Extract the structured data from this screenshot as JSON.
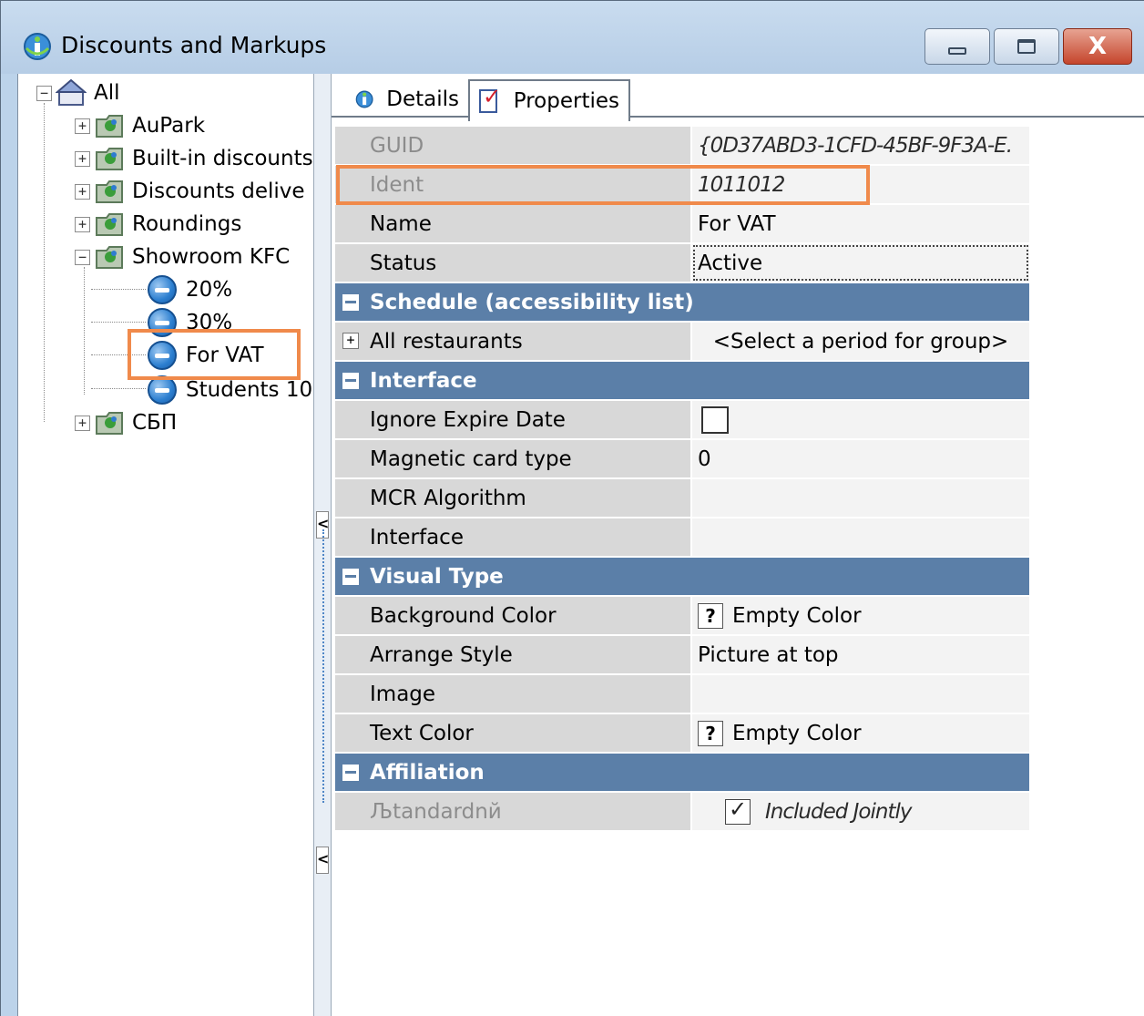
{
  "window": {
    "title": "Discounts and Markups",
    "minimize_label": "",
    "maximize_label": "",
    "close_label": "X"
  },
  "tree": {
    "root": {
      "label": "All",
      "expander": "−"
    },
    "groups": [
      {
        "label": "AuPark",
        "expander": "+"
      },
      {
        "label": "Built-in discounts",
        "expander": "+"
      },
      {
        "label": "Discounts delive",
        "expander": "+"
      },
      {
        "label": "Roundings",
        "expander": "+"
      },
      {
        "label": "Showroom KFC",
        "expander": "−"
      }
    ],
    "children": [
      {
        "label": "20%"
      },
      {
        "label": "30%"
      },
      {
        "label": "For VAT",
        "selected": true
      },
      {
        "label": "Students 10:"
      }
    ],
    "last_group": {
      "label": "СБП",
      "expander": "+"
    }
  },
  "tabs": {
    "details": "Details",
    "properties": "Properties",
    "active": "properties"
  },
  "properties": {
    "guid": {
      "name": "GUID",
      "value": "{0D37ABD3-1CFD-45BF-9F3A-E."
    },
    "ident": {
      "name": "Ident",
      "value": "1011012"
    },
    "name": {
      "name": "Name",
      "value": "For VAT"
    },
    "status": {
      "name": "Status",
      "value": "Active"
    },
    "schedule_header": "Schedule (accessibility list)",
    "all_restaurants": {
      "name": "All restaurants",
      "value": "<Select a period for group>",
      "expander": "+"
    },
    "interface_header": "Interface",
    "ignore_expire": {
      "name": "Ignore Expire Date",
      "checked": false
    },
    "magnetic_card_type": {
      "name": "Magnetic card type",
      "value": "0"
    },
    "mcr_algorithm": {
      "name": "MCR Algorithm",
      "value": ""
    },
    "interface": {
      "name": "Interface",
      "value": ""
    },
    "visual_header": "Visual Type",
    "background_color": {
      "name": "Background Color",
      "icon": "?",
      "value": "Empty Color"
    },
    "arrange_style": {
      "name": "Arrange Style",
      "value": "Picture at top"
    },
    "image": {
      "name": "Image",
      "value": ""
    },
    "text_color": {
      "name": "Text Color",
      "icon": "?",
      "value": "Empty Color"
    },
    "affiliation_header": "Affiliation",
    "standard": {
      "name": "Љtandardnй",
      "value": "Included Jointly",
      "checked": true
    }
  },
  "splitter": {
    "arrow": "<"
  },
  "colors": {
    "category_header": "#5b7fa8",
    "highlight": "#f08a4b",
    "name_cell": "#d8d8d8",
    "value_cell": "#f3f3f3"
  }
}
